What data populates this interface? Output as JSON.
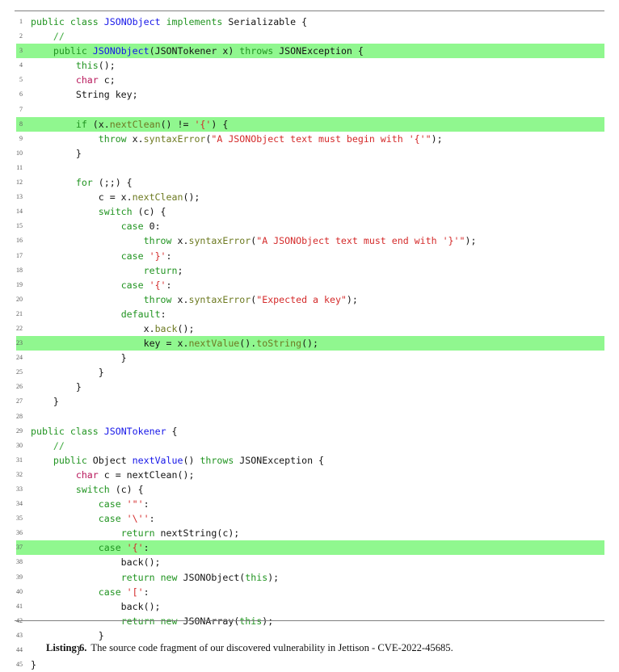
{
  "figure": {
    "type": "code-listing",
    "language": "java",
    "top_rule": true,
    "bottom_rule": true,
    "highlight_color": "#90f78f",
    "highlighted_line_numbers": [
      3,
      8,
      23,
      37
    ],
    "caption": {
      "label": "Listing 6.",
      "text": "The source code fragment of our discovered vulnerability in Jettison - CVE-2022-45685."
    }
  },
  "colors": {
    "keyword": "#219421",
    "declaration": "#1515e8",
    "string": "#d42a2a",
    "method_call": "#6d7a21",
    "primitive_type": "#b8195c",
    "comment": "#3aa83a",
    "plain": "#141414",
    "line_number": "#5c5c5c",
    "rule": "#808080",
    "highlight": "#90f78f"
  },
  "code": {
    "lines": [
      {
        "n": "1",
        "hl": false,
        "text": "public class JSONObject implements Serializable {"
      },
      {
        "n": "2",
        "hl": false,
        "text": "    //"
      },
      {
        "n": "3",
        "hl": true,
        "text": "    public JSONObject(JSONTokener x) throws JSONException {"
      },
      {
        "n": "4",
        "hl": false,
        "text": "        this();"
      },
      {
        "n": "5",
        "hl": false,
        "text": "        char c;"
      },
      {
        "n": "6",
        "hl": false,
        "text": "        String key;"
      },
      {
        "n": "7",
        "hl": false,
        "text": ""
      },
      {
        "n": "8",
        "hl": true,
        "text": "        if (x.nextClean() != '{') {"
      },
      {
        "n": "9",
        "hl": false,
        "text": "            throw x.syntaxError(\"A JSONObject text must begin with '{'\");"
      },
      {
        "n": "10",
        "hl": false,
        "text": "        }"
      },
      {
        "n": "11",
        "hl": false,
        "text": ""
      },
      {
        "n": "12",
        "hl": false,
        "text": "        for (;;) {"
      },
      {
        "n": "13",
        "hl": false,
        "text": "            c = x.nextClean();"
      },
      {
        "n": "14",
        "hl": false,
        "text": "            switch (c) {"
      },
      {
        "n": "15",
        "hl": false,
        "text": "                case 0:"
      },
      {
        "n": "16",
        "hl": false,
        "text": "                    throw x.syntaxError(\"A JSONObject text must end with '}'\");"
      },
      {
        "n": "17",
        "hl": false,
        "text": "                case '}':"
      },
      {
        "n": "18",
        "hl": false,
        "text": "                    return;"
      },
      {
        "n": "19",
        "hl": false,
        "text": "                case '{':"
      },
      {
        "n": "20",
        "hl": false,
        "text": "                    throw x.syntaxError(\"Expected a key\");"
      },
      {
        "n": "21",
        "hl": false,
        "text": "                default:"
      },
      {
        "n": "22",
        "hl": false,
        "text": "                    x.back();"
      },
      {
        "n": "23",
        "hl": true,
        "text": "                    key = x.nextValue().toString();"
      },
      {
        "n": "24",
        "hl": false,
        "text": "                }"
      },
      {
        "n": "25",
        "hl": false,
        "text": "            }"
      },
      {
        "n": "26",
        "hl": false,
        "text": "        }"
      },
      {
        "n": "27",
        "hl": false,
        "text": "    }"
      },
      {
        "n": "28",
        "hl": false,
        "text": ""
      },
      {
        "n": "29",
        "hl": false,
        "text": "public class JSONTokener {"
      },
      {
        "n": "30",
        "hl": false,
        "text": "    //"
      },
      {
        "n": "31",
        "hl": false,
        "text": "    public Object nextValue() throws JSONException {"
      },
      {
        "n": "32",
        "hl": false,
        "text": "        char c = nextClean();"
      },
      {
        "n": "33",
        "hl": false,
        "text": "        switch (c) {"
      },
      {
        "n": "34",
        "hl": false,
        "text": "            case '\"':"
      },
      {
        "n": "35",
        "hl": false,
        "text": "            case '\\'':"
      },
      {
        "n": "36",
        "hl": false,
        "text": "                return nextString(c);"
      },
      {
        "n": "37",
        "hl": true,
        "text": "            case '{':"
      },
      {
        "n": "38",
        "hl": false,
        "text": "                back();"
      },
      {
        "n": "39",
        "hl": false,
        "text": "                return new JSONObject(this);"
      },
      {
        "n": "40",
        "hl": false,
        "text": "            case '[':"
      },
      {
        "n": "41",
        "hl": false,
        "text": "                back();"
      },
      {
        "n": "42",
        "hl": false,
        "text": "                return new JSONArray(this);"
      },
      {
        "n": "43",
        "hl": false,
        "text": "            }"
      },
      {
        "n": "44",
        "hl": false,
        "text": "        }"
      },
      {
        "n": "45",
        "hl": false,
        "text": "}"
      }
    ],
    "tokens": {
      "keywords": [
        "public",
        "class",
        "implements",
        "throws",
        "if",
        "for",
        "switch",
        "case",
        "return",
        "new",
        "this",
        "throw",
        "default"
      ],
      "primitive_types": [
        "char"
      ],
      "declared_names": [
        "JSONObject",
        "JSONTokener",
        "nextValue"
      ],
      "method_calls": [
        "nextClean",
        "syntaxError",
        "nextValue",
        "toString",
        "back"
      ],
      "comments": [
        "//"
      ],
      "strings": [
        "\"A JSONObject text must begin with '{'\"",
        "\"A JSONObject text must end with '}'\"",
        "\"Expected a key\"",
        "'{'",
        "'}'",
        "'\"'",
        "'\\''",
        "'['"
      ]
    }
  }
}
